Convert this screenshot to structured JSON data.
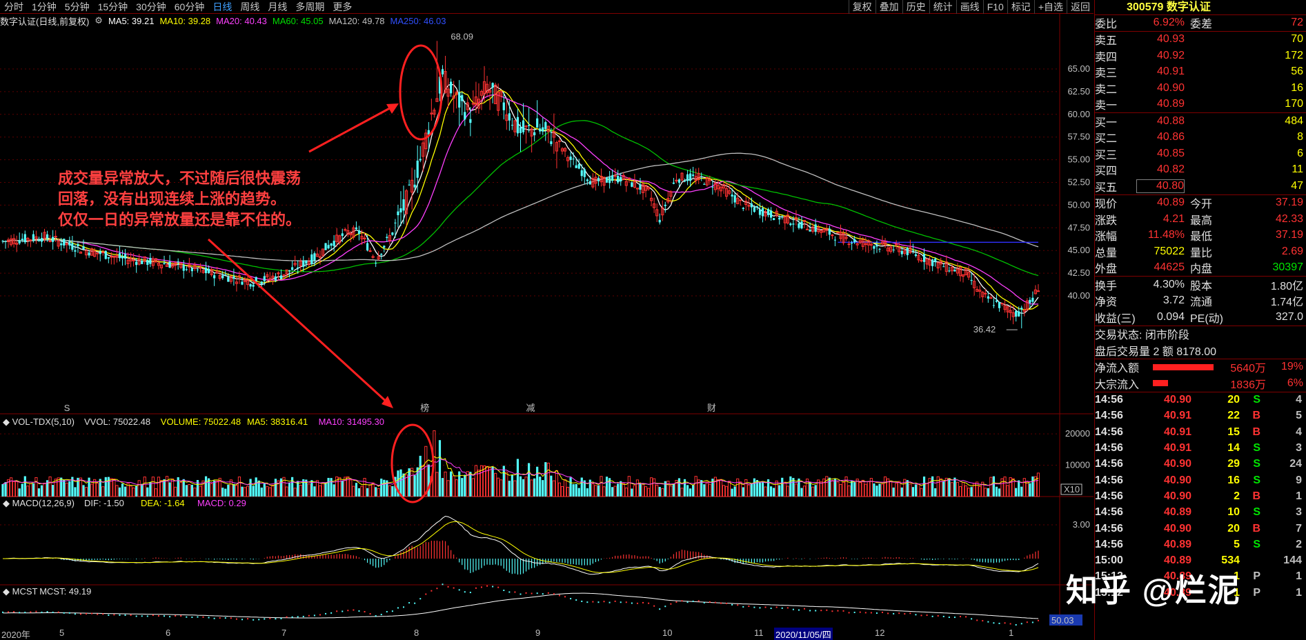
{
  "periods": [
    "分时",
    "1分钟",
    "5分钟",
    "15分钟",
    "30分钟",
    "60分钟",
    "日线",
    "周线",
    "月线",
    "多周期",
    "更多"
  ],
  "toolbar": [
    "复权",
    "叠加",
    "历史",
    "统计",
    "画线",
    "F10",
    "标记",
    "+自选",
    "返回"
  ],
  "stock": {
    "code": "300579",
    "name": "数字认证",
    "title": "数字认证(日线,前复权)"
  },
  "ma": {
    "ma5": "MA5: 39.21",
    "ma10": "MA10: 39.28",
    "ma20": "MA20: 40.43",
    "ma60": "MA60: 45.05",
    "ma120": "MA120: 49.78",
    "ma250": "MA250: 46.03"
  },
  "colors": {
    "up": "#ff3232",
    "down": "#54ffff",
    "ma5": "#ffffff",
    "ma10": "#ffff00",
    "ma20": "#ff40ff",
    "ma60": "#00c000",
    "ma120": "#c0c0c0",
    "ma250": "#3030ff"
  },
  "price_axis": [
    "65.00",
    "62.50",
    "60.00",
    "57.50",
    "55.00",
    "52.50",
    "50.00",
    "47.50",
    "45.00",
    "42.50",
    "40.00"
  ],
  "high_label": "68.09",
  "low_label": "36.42",
  "vol": {
    "title": "VOL-TDX(5,10)",
    "vvol": "VVOL: 75022.48",
    "volume": "VOLUME: 75022.48",
    "ma5": "MA5: 38316.41",
    "ma10": "MA10: 31495.30",
    "axis": [
      "20000",
      "10000"
    ],
    "unit": "X10"
  },
  "macd": {
    "title": "MACD(12,26,9)",
    "dif": "DIF: -1.50",
    "dea": "DEA: -1.64",
    "macd": "MACD: 0.29",
    "axis": "3.00"
  },
  "mcst": {
    "title": "MCST",
    "value": "MCST: 49.19",
    "axis": "50.03"
  },
  "events": [
    {
      "t": "S"
    },
    {
      "t": "榜"
    },
    {
      "t": "减"
    },
    {
      "t": "财"
    }
  ],
  "xaxis": [
    "2020年",
    "5",
    "6",
    "7",
    "8",
    "9",
    "10",
    "11",
    "2020/11/05/四",
    "12",
    "1"
  ],
  "period_label": "日线",
  "annotation": "成交量异常放大，不过随后很快震荡\n回落，没有出现连续上涨的趋势。\n仅仅一日的异常放量还是靠不住的。",
  "watermark": "知乎 @烂泥",
  "orderbook": {
    "weibi": {
      "l1": "委比",
      "v1": "6.92%",
      "l2": "委差",
      "v2": "72"
    },
    "asks": [
      {
        "l": "卖五",
        "p": "40.93",
        "v": "70"
      },
      {
        "l": "卖四",
        "p": "40.92",
        "v": "172"
      },
      {
        "l": "卖三",
        "p": "40.91",
        "v": "56"
      },
      {
        "l": "卖二",
        "p": "40.90",
        "v": "16"
      },
      {
        "l": "卖一",
        "p": "40.89",
        "v": "170"
      }
    ],
    "bids": [
      {
        "l": "买一",
        "p": "40.88",
        "v": "484"
      },
      {
        "l": "买二",
        "p": "40.86",
        "v": "8"
      },
      {
        "l": "买三",
        "p": "40.85",
        "v": "6"
      },
      {
        "l": "买四",
        "p": "40.82",
        "v": "11"
      },
      {
        "l": "买五",
        "p": "40.80",
        "v": "47"
      }
    ]
  },
  "quote": [
    {
      "l1": "现价",
      "v1": "40.89",
      "l2": "今开",
      "v2": "37.19"
    },
    {
      "l1": "涨跌",
      "v1": "4.21",
      "l2": "最高",
      "v2": "42.33"
    },
    {
      "l1": "涨幅",
      "v1": "11.48%",
      "l2": "最低",
      "v2": "37.19"
    },
    {
      "l1": "总量",
      "v1": "75022",
      "l2": "量比",
      "v2": "2.69"
    },
    {
      "l1": "外盘",
      "v1": "44625",
      "l2": "内盘",
      "v2": "30397"
    }
  ],
  "stats": [
    {
      "l1": "换手",
      "v1": "4.30%",
      "l2": "股本",
      "v2": "1.80亿"
    },
    {
      "l1": "净资",
      "v1": "3.72",
      "l2": "流通",
      "v2": "1.74亿"
    },
    {
      "l1": "收益(三)",
      "v1": "0.094",
      "l2": "PE(动)",
      "v2": "327.0"
    }
  ],
  "status": {
    "trade_state": "交易状态: 闭市阶段",
    "after_hours": "盘后交易量 2 额 8178.00"
  },
  "flows": [
    {
      "l": "净流入额",
      "v": "5640万",
      "p": "19%"
    },
    {
      "l": "大宗流入",
      "v": "1836万",
      "p": "6%"
    }
  ],
  "ticks": [
    {
      "t": "14:56",
      "p": "40.90",
      "v": "20",
      "d": "S",
      "n": "4"
    },
    {
      "t": "14:56",
      "p": "40.91",
      "v": "22",
      "d": "B",
      "n": "5"
    },
    {
      "t": "14:56",
      "p": "40.91",
      "v": "15",
      "d": "B",
      "n": "4"
    },
    {
      "t": "14:56",
      "p": "40.91",
      "v": "14",
      "d": "S",
      "n": "3"
    },
    {
      "t": "14:56",
      "p": "40.90",
      "v": "29",
      "d": "S",
      "n": "24"
    },
    {
      "t": "14:56",
      "p": "40.90",
      "v": "16",
      "d": "S",
      "n": "9"
    },
    {
      "t": "14:56",
      "p": "40.90",
      "v": "2",
      "d": "B",
      "n": "1"
    },
    {
      "t": "14:56",
      "p": "40.89",
      "v": "10",
      "d": "S",
      "n": "3"
    },
    {
      "t": "14:56",
      "p": "40.90",
      "v": "20",
      "d": "B",
      "n": "7"
    },
    {
      "t": "14:56",
      "p": "40.89",
      "v": "5",
      "d": "S",
      "n": "2"
    },
    {
      "t": "15:00",
      "p": "40.89",
      "v": "534",
      "d": "",
      "n": "144"
    },
    {
      "t": "15:12",
      "p": "40.89",
      "v": "1",
      "d": "P",
      "n": "1"
    },
    {
      "t": "15:12",
      "p": "40.89",
      "v": "1",
      "d": "P",
      "n": "1"
    }
  ]
}
